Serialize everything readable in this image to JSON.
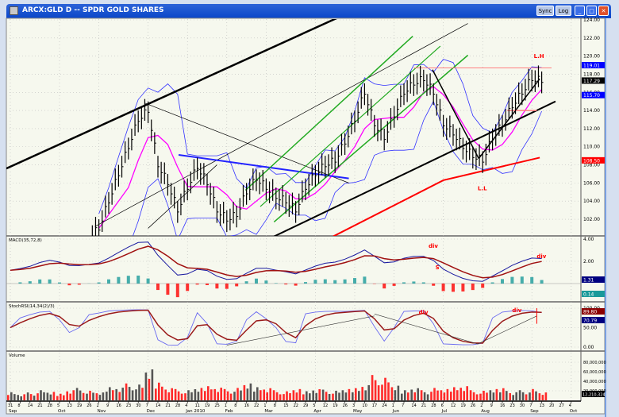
{
  "window": {
    "title": "ARCX:GLD D -- SPDR GOLD SHARES",
    "buttons": {
      "sync": "Sync",
      "log": "Log",
      "minimize": "_",
      "maximize": "□",
      "close": "✕"
    }
  },
  "colors": {
    "title_bar": "#1450d0",
    "background": "#f6f8ee",
    "price_bar": "#000000",
    "ma": "#ff00ff",
    "bands": "#3333ff",
    "long_ma": "#ff0000",
    "macd_line": "#1a1aa0",
    "macd_signal": "#a01010",
    "histogram": "#1a9a9a",
    "volume_up": "#555555",
    "volume_down": "#ff2a2a",
    "annotation": "#ff0000"
  },
  "chart_data": [
    {
      "type": "ohlc",
      "panel": "price",
      "title": "ARCX:GLD D -- SPDR GOLD SHARES",
      "ylim": [
        100,
        125
      ],
      "y_ticks": [
        "102.00",
        "104.00",
        "106.00",
        "108.00",
        "110.00",
        "112.00",
        "114.00",
        "116.00",
        "118.00",
        "120.00",
        "122.00",
        "124.00"
      ],
      "grid": true,
      "weeks_start_index": 9,
      "close": [
        101,
        104,
        107,
        110,
        113,
        114,
        108,
        106,
        103,
        105.5,
        107.8,
        106,
        103,
        102,
        102.5,
        105,
        106.5,
        105.5,
        104.5,
        104,
        103,
        105.5,
        107,
        108,
        108.5,
        110.5,
        113,
        116,
        112.5,
        111,
        113.5,
        116,
        117,
        117.5,
        116,
        112.5,
        111.5,
        110,
        109,
        108.5,
        111,
        112.5,
        114.5,
        116,
        117.5,
        117.3
      ],
      "last_value_labels": [
        {
          "text": "119.01",
          "color": "#0000ff",
          "value": 119.0
        },
        {
          "text": "117.29",
          "color": "#000000",
          "value": 117.3
        },
        {
          "text": "115.70",
          "color": "#0000ff",
          "value": 115.7
        },
        {
          "text": "108.50",
          "color": "#ff0000",
          "value": 108.5
        }
      ],
      "trendlines": [
        {
          "color": "#000000",
          "width": 2.5,
          "from": [
            -0.4,
            107.6
          ],
          "to": [
            33.6,
            124.4
          ]
        },
        {
          "color": "#000000",
          "width": 0.7,
          "from": [
            8.6,
            101.2
          ],
          "to": [
            46.5,
            123.6
          ]
        },
        {
          "color": "#000000",
          "width": 2,
          "from": [
            26.8,
            100.1
          ],
          "to": [
            55.4,
            115
          ]
        },
        {
          "color": "#000000",
          "width": 0.7,
          "from": [
            13.7,
            114.8
          ],
          "to": [
            34.4,
            106
          ]
        },
        {
          "color": "#000000",
          "width": 0.7,
          "from": [
            14,
            101
          ],
          "to": [
            21,
            108
          ]
        },
        {
          "color": "#2222ff",
          "width": 2,
          "from": [
            17.1,
            109.1
          ],
          "to": [
            34.4,
            106.5
          ]
        },
        {
          "color": "#22aa22",
          "width": 1.5,
          "from": [
            23.9,
            105.2
          ],
          "to": [
            40.9,
            122.2
          ]
        },
        {
          "color": "#22aa22",
          "width": 1.2,
          "from": [
            25.4,
            103.4
          ],
          "to": [
            43.7,
            121.1
          ]
        },
        {
          "color": "#22aa22",
          "width": 1.5,
          "from": [
            26.8,
            101.7
          ],
          "to": [
            46.5,
            120.1
          ]
        },
        {
          "color": "#000000",
          "width": 1.5,
          "from": [
            42.9,
            118.5
          ],
          "to": [
            47.6,
            108.7
          ]
        },
        {
          "color": "#000000",
          "width": 1.5,
          "from": [
            47.6,
            108.7
          ],
          "to": [
            53.8,
            117.5
          ]
        },
        {
          "color": "#ff8080",
          "width": 1,
          "from": [
            41,
            118.7
          ],
          "to": [
            55,
            118.7
          ]
        },
        {
          "color": "#ff8080",
          "width": 1.5,
          "from": [
            50.5,
            114
          ],
          "to": [
            53.5,
            114
          ]
        }
      ],
      "long_ma": {
        "from": [
          32.8,
          100.1
        ],
        "mid": [
          44,
          106.3
        ],
        "to": [
          53.8,
          108.8
        ]
      },
      "annotations": [
        {
          "text": "L.H",
          "week": 53.2,
          "value": 119.8
        },
        {
          "text": "L.L",
          "week": 47.5,
          "value": 105.2
        }
      ]
    },
    {
      "type": "line",
      "panel": "macd",
      "label": "MACD(35,72,8)",
      "y_ticks": [
        "2.00",
        "4.00"
      ],
      "last_value_labels": [
        {
          "text": "1.31",
          "color": "#000080"
        },
        {
          "text": "0.14",
          "color": "#1a9a9a"
        }
      ],
      "annotations": [
        {
          "text": "div",
          "week": 42.5,
          "value": 3.2
        },
        {
          "text": "S",
          "week": 43.2,
          "value": 1.3
        },
        {
          "text": "div",
          "week": 53.5,
          "value": 2.3
        }
      ]
    },
    {
      "type": "line",
      "panel": "stochastic",
      "label": "StochRSI(14,34(2)/3)",
      "ylim": [
        0,
        100
      ],
      "y_ticks": [
        "0.00",
        "50.00",
        "100.00"
      ],
      "last_value_labels": [
        {
          "text": "89.80",
          "color": "#8b0000"
        },
        {
          "text": "70.79",
          "color": "#000080"
        }
      ],
      "annotations": [
        {
          "text": "div",
          "week": 41.5,
          "value": 85
        },
        {
          "text": "div",
          "week": 51,
          "value": 90
        }
      ]
    },
    {
      "type": "bar",
      "panel": "volume",
      "label": "Volume",
      "y_ticks": [
        "20,000,000",
        "40,000,000",
        "60,000,000",
        "80,000,000"
      ],
      "last_value_label": "12,210,324",
      "volume_millions": [
        16,
        12,
        14,
        18,
        15,
        13,
        20,
        22,
        17,
        14,
        26,
        25,
        30,
        28,
        55,
        35,
        24,
        20,
        18,
        22,
        28,
        25,
        20,
        22,
        30,
        26,
        24,
        18,
        16,
        20,
        18,
        22,
        19,
        17,
        20,
        24,
        30,
        45,
        40,
        26,
        20,
        24,
        18,
        22,
        20,
        26,
        28,
        18,
        17,
        20,
        24,
        16,
        18,
        20,
        14
      ]
    }
  ],
  "x_axis": {
    "day_labels": [
      "31",
      "8",
      "14",
      "21",
      "28",
      "5",
      "13",
      "19",
      "26",
      "2",
      "9",
      "16",
      "23",
      "30",
      "7",
      "14",
      "21",
      "28",
      "4",
      "11",
      "19",
      "25",
      "1",
      "8",
      "16",
      "22",
      "1",
      "8",
      "15",
      "22",
      "29",
      "5",
      "12",
      "19",
      "26",
      "3",
      "10",
      "17",
      "24",
      "1",
      "7",
      "14",
      "21",
      "28",
      "6",
      "12",
      "19",
      "26",
      "2",
      "9",
      "16",
      "23",
      "30",
      "7",
      "13",
      "20",
      "27",
      "4"
    ],
    "month_labels": [
      {
        "text": "Sep",
        "week": 0
      },
      {
        "text": "Oct",
        "week": 5
      },
      {
        "text": "Nov",
        "week": 9
      },
      {
        "text": "Dec",
        "week": 14
      },
      {
        "text": "Jan 2010",
        "week": 18
      },
      {
        "text": "Feb",
        "week": 22
      },
      {
        "text": "Mar",
        "week": 26
      },
      {
        "text": "Apr",
        "week": 31
      },
      {
        "text": "May",
        "week": 35
      },
      {
        "text": "Jun",
        "week": 39
      },
      {
        "text": "Jul",
        "week": 44
      },
      {
        "text": "Aug",
        "week": 48
      },
      {
        "text": "Sep",
        "week": 53
      },
      {
        "text": "Oct",
        "week": 57
      }
    ]
  }
}
